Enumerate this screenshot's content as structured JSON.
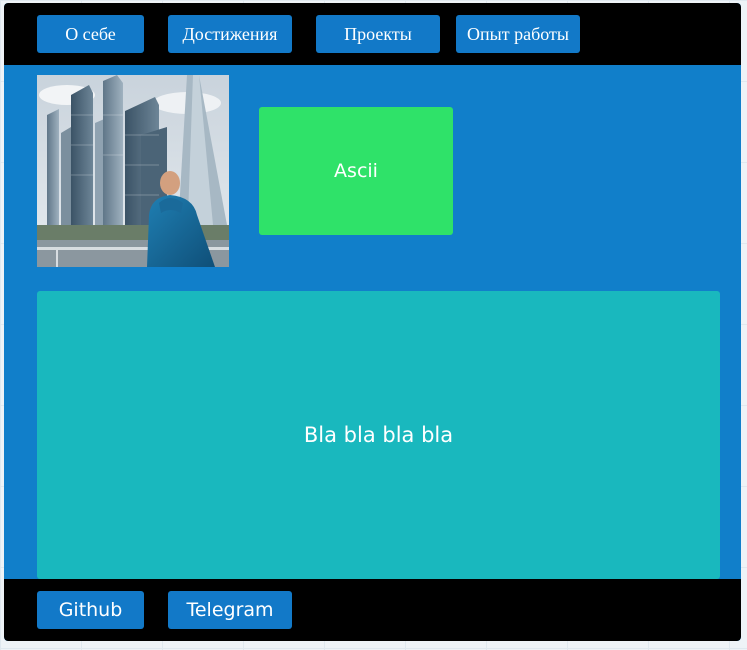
{
  "nav": {
    "items": [
      {
        "label": "О себе"
      },
      {
        "label": "Достижения"
      },
      {
        "label": "Проекты"
      },
      {
        "label": "Опыт работы"
      }
    ]
  },
  "content": {
    "ascii_label": "Ascii",
    "main_text": "Bla bla bla bla"
  },
  "footer": {
    "links": [
      {
        "label": "Github"
      },
      {
        "label": "Telegram"
      }
    ]
  },
  "colors": {
    "page_background": "#117fca",
    "bars": "#000000",
    "button": "#1279c8",
    "ascii_card": "#2fe269",
    "main_card": "#19b8be"
  }
}
